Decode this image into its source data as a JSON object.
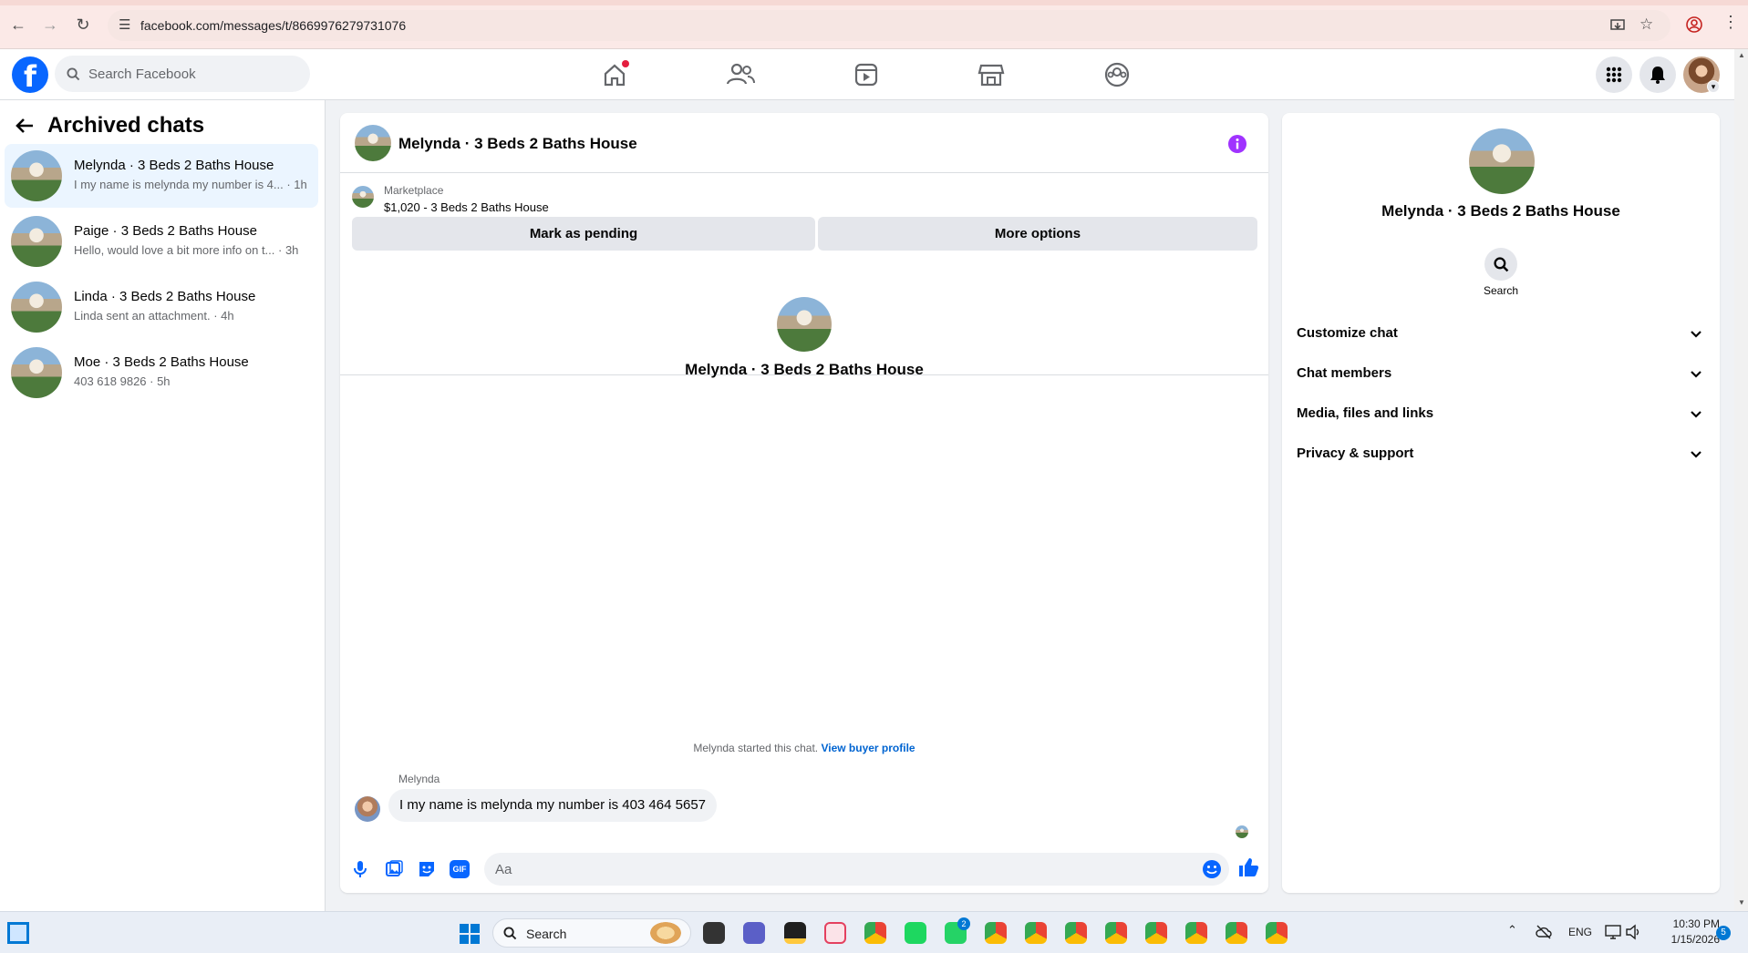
{
  "browser": {
    "url": "facebook.com/messages/t/8669976279731076"
  },
  "header": {
    "search_placeholder": "Search Facebook"
  },
  "sidebar": {
    "title": "Archived chats",
    "chats": [
      {
        "name": "Melynda · 3 Beds 2 Baths House",
        "preview": "I my name is melynda my number is 4... · 1h",
        "active": true
      },
      {
        "name": "Paige · 3 Beds 2 Baths House",
        "preview": "Hello, would love a bit more info on t... · 3h",
        "active": false
      },
      {
        "name": "Linda · 3 Beds 2 Baths House",
        "preview": "Linda sent an attachment. · 4h",
        "active": false
      },
      {
        "name": "Moe · 3 Beds 2 Baths House",
        "preview": "403 618 9826 · 5h",
        "active": false
      }
    ]
  },
  "conversation": {
    "title": "Melynda · 3 Beds 2 Baths House",
    "marketplace_label": "Marketplace",
    "listing": "$1,020 - 3 Beds 2 Baths House",
    "mark_pending_label": "Mark as pending",
    "more_options_label": "More options",
    "intro_name": "Melynda · 3 Beds 2 Baths House",
    "started_text": "Melynda started this chat.",
    "view_profile_link": "View buyer profile",
    "sender": "Melynda",
    "message": "I my name is melynda  my number is 403 464 5657",
    "composer_placeholder": "Aa"
  },
  "details": {
    "name": "Melynda · 3 Beds 2 Baths House",
    "search_label": "Search",
    "sections": [
      "Customize chat",
      "Chat members",
      "Media, files and links",
      "Privacy & support"
    ]
  },
  "taskbar": {
    "search_label": "Search",
    "lang": "ENG",
    "time": "10:30 PM",
    "date": "1/15/2026",
    "whatsapp_badge": "2",
    "notif_count": "5"
  },
  "colors": {
    "fb_blue": "#0866ff",
    "messenger_purple": "#a033ff",
    "link_blue": "#0064d1"
  }
}
